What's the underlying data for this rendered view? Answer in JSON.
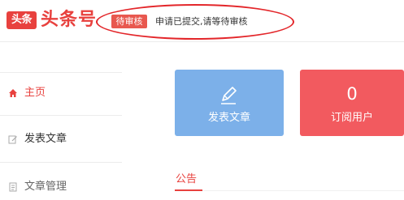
{
  "header": {
    "logo_badge": "头条",
    "logo_text": "头条号",
    "status_badge": "待审核",
    "status_message": "申请已提交,请等待审核"
  },
  "sidebar": {
    "items": [
      {
        "label": "主页",
        "icon": "home-icon",
        "active": true
      },
      {
        "label": "发表文章",
        "icon": "edit-icon"
      },
      {
        "label": "文章管理",
        "icon": "document-icon"
      }
    ]
  },
  "cards": {
    "publish": {
      "label": "发表文章",
      "icon": "pen-icon",
      "color": "#7cb0e9"
    },
    "subscribers": {
      "value": "0",
      "label": "订阅用户",
      "color": "#f25a5f"
    }
  },
  "notice": {
    "title": "公告"
  },
  "colors": {
    "brand": "#e8413e",
    "annotation": "#e3262a"
  }
}
